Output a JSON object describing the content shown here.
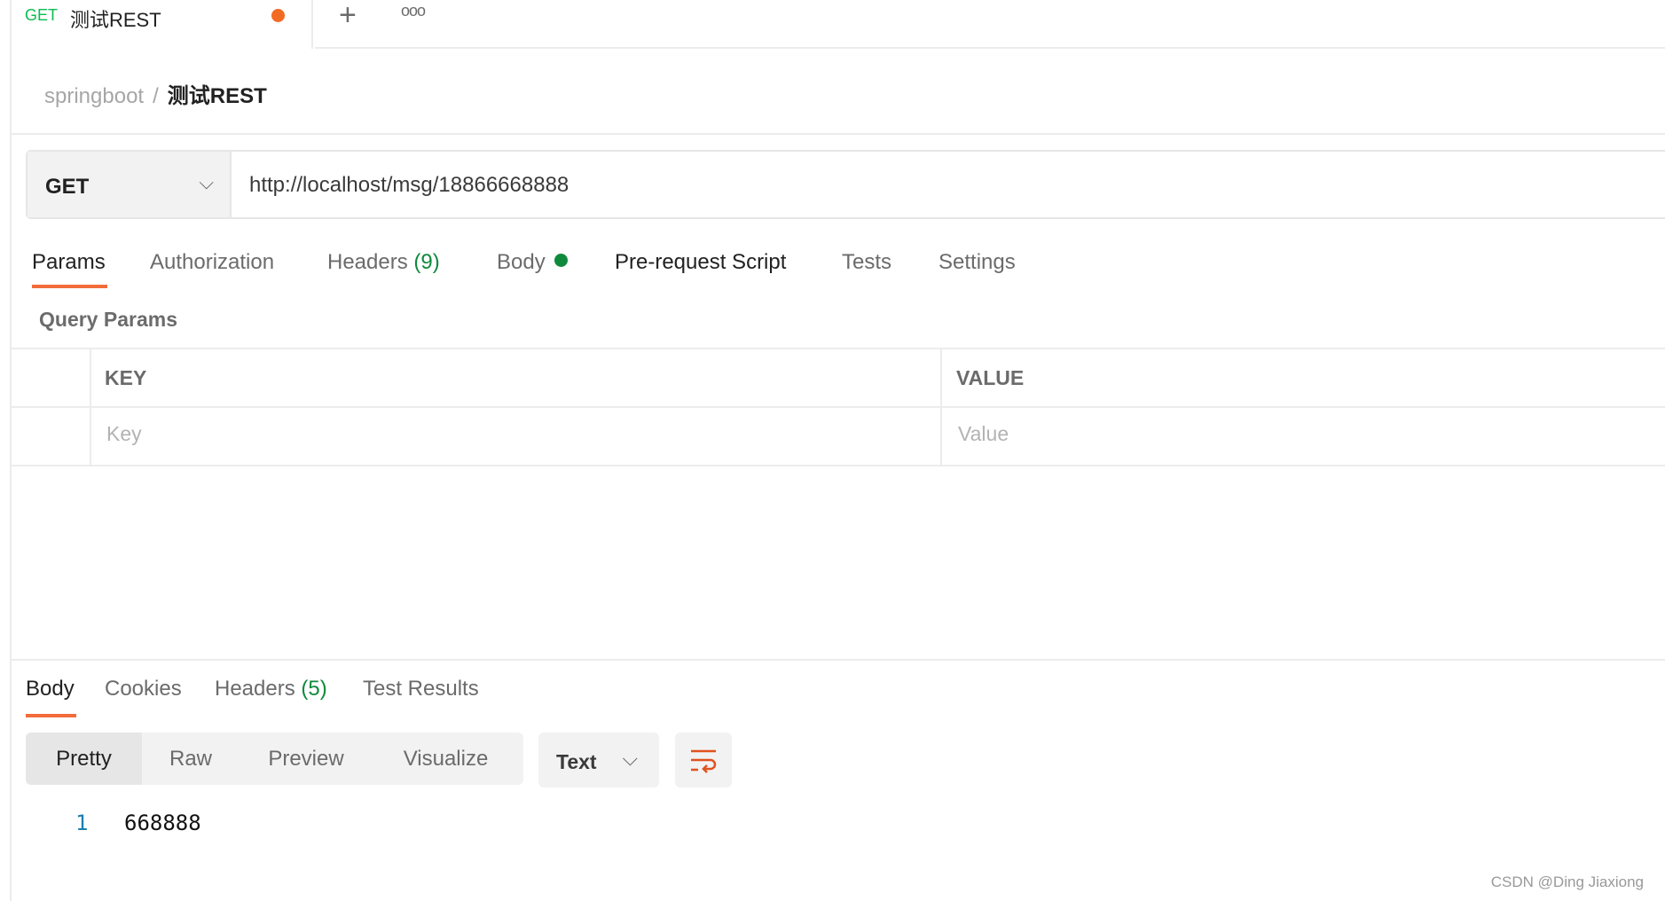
{
  "tab": {
    "method": "GET",
    "title": "测试REST",
    "unsaved_color": "#f26b24"
  },
  "tabbar": {
    "new_tab_icon": "plus-icon",
    "more_icon": "more-dots-icon"
  },
  "breadcrumb": {
    "parent": "springboot",
    "separator": "/",
    "current": "测试REST"
  },
  "request": {
    "method": "GET",
    "url": "http://localhost/msg/18866668888"
  },
  "request_tabs": [
    {
      "label": "Params",
      "active": true
    },
    {
      "label": "Authorization"
    },
    {
      "label": "Headers",
      "count": "(9)"
    },
    {
      "label": "Body",
      "has_dot": true
    },
    {
      "label": "Pre-request Script"
    },
    {
      "label": "Tests"
    },
    {
      "label": "Settings"
    }
  ],
  "query_params": {
    "title": "Query Params",
    "key_header": "KEY",
    "value_header": "VALUE",
    "key_placeholder": "Key",
    "value_placeholder": "Value"
  },
  "response_tabs": [
    {
      "label": "Body",
      "active": true
    },
    {
      "label": "Cookies"
    },
    {
      "label": "Headers",
      "count": "(5)"
    },
    {
      "label": "Test Results"
    }
  ],
  "view_modes": [
    "Pretty",
    "Raw",
    "Preview",
    "Visualize"
  ],
  "active_view": "Pretty",
  "format": "Text",
  "response_body": {
    "line": "1",
    "content": "668888"
  },
  "watermark": "CSDN @Ding Jiaxiong",
  "colors": {
    "accent": "#f26b3a",
    "get": "#0cbb52",
    "count_green": "#0f8a3c"
  }
}
